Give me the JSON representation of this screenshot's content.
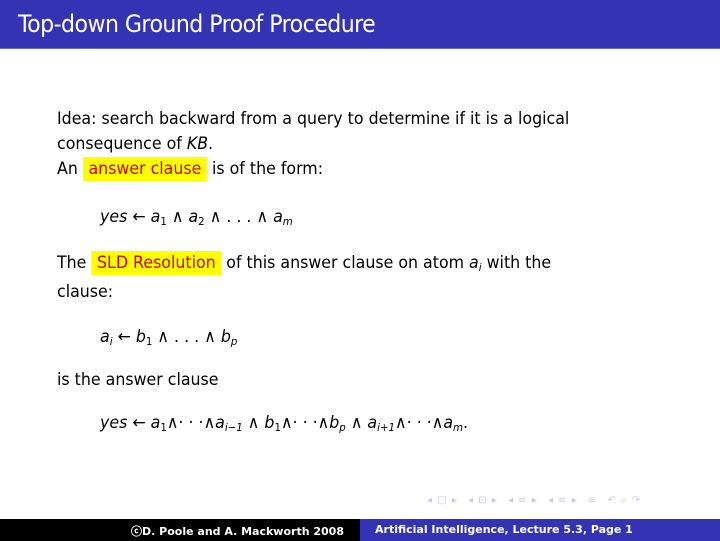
{
  "slide": {
    "title": "Top-down Ground Proof Procedure",
    "para1_line1": "Idea: search backward from a query to determine if it is a logical",
    "para1_line2_prefix": "consequence of ",
    "para1_kb": "KB",
    "para1_line2_suffix": ".",
    "para2_prefix": "An",
    "para2_highlight": "answer clause",
    "para2_suffix": "is of the form:",
    "formula1": {
      "yes": "yes",
      "arrow": "←",
      "a": "a",
      "sub1": "1",
      "and": "∧",
      "sub2": "2",
      "dots": ". . .",
      "subm": "m"
    },
    "para3_prefix": "The",
    "para3_highlight": "SLD Resolution",
    "para3_middle": "of this answer clause on atom",
    "para3_atom": "a",
    "para3_atom_sub": "i",
    "para3_suffix": "with the",
    "para3_line2": "clause:",
    "formula2": {
      "a": "a",
      "subi": "i",
      "arrow": "←",
      "b": "b",
      "sub1": "1",
      "and": "∧",
      "dots": ". . .",
      "subp": "p"
    },
    "para4": "is the answer clause",
    "formula3": {
      "yes": "yes",
      "arrow": "←",
      "a": "a",
      "b": "b",
      "sub1": "1",
      "subi_minus": "i−1",
      "subi_plus": "i+1",
      "subp": "p",
      "subm": "m",
      "and": "∧",
      "cdots": "· · ·",
      "period": "."
    }
  },
  "nav": {
    "icons": [
      "◂ □ ▸",
      "◂ ⊡ ▸",
      "◂ ≡ ▸",
      "◂ ≡ ▸",
      "≡",
      "↶ ⌕ ↷"
    ]
  },
  "footer": {
    "left": "ⓒD. Poole and A. Mackworth 2008",
    "right": "Artificial Intelligence, Lecture 5.3, Page 1"
  },
  "colors": {
    "title_bar": "#3333b3",
    "highlight_bg": "#ffff00",
    "highlight_text": "#cc0000",
    "footer_left": "#000000"
  }
}
